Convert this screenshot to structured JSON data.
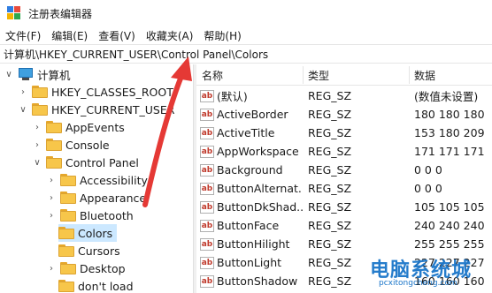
{
  "window": {
    "title": "注册表编辑器"
  },
  "menu": [
    "文件(F)",
    "编辑(E)",
    "查看(V)",
    "收藏夹(A)",
    "帮助(H)"
  ],
  "address": "计算机\\HKEY_CURRENT_USER\\Control Panel\\Colors",
  "tree": [
    {
      "label": "计算机",
      "expanded": true,
      "icon": "computer-icon"
    },
    {
      "label": "HKEY_CLASSES_ROOT",
      "expanded": false,
      "icon": "folder-icon"
    },
    {
      "label": "HKEY_CURRENT_USER",
      "expanded": true,
      "icon": "folder-icon"
    },
    {
      "label": "AppEvents",
      "expanded": false,
      "icon": "folder-icon"
    },
    {
      "label": "Console",
      "expanded": false,
      "icon": "folder-icon"
    },
    {
      "label": "Control Panel",
      "expanded": true,
      "icon": "folder-icon"
    },
    {
      "label": "Accessibility",
      "expanded": false,
      "icon": "folder-icon"
    },
    {
      "label": "Appearance",
      "expanded": false,
      "icon": "folder-icon"
    },
    {
      "label": "Bluetooth",
      "expanded": false,
      "icon": "folder-icon"
    },
    {
      "label": "Colors",
      "selected": true,
      "icon": "folder-icon"
    },
    {
      "label": "Cursors",
      "icon": "folder-icon"
    },
    {
      "label": "Desktop",
      "expanded": false,
      "icon": "folder-icon"
    },
    {
      "label": "don't load",
      "icon": "folder-icon"
    }
  ],
  "columns": {
    "name": "名称",
    "type": "类型",
    "data": "数据"
  },
  "values": [
    {
      "name": "(默认)",
      "type": "REG_SZ",
      "data": "(数值未设置)"
    },
    {
      "name": "ActiveBorder",
      "type": "REG_SZ",
      "data": "180 180 180"
    },
    {
      "name": "ActiveTitle",
      "type": "REG_SZ",
      "data": "153 180 209"
    },
    {
      "name": "AppWorkspace",
      "type": "REG_SZ",
      "data": "171 171 171"
    },
    {
      "name": "Background",
      "type": "REG_SZ",
      "data": "0 0 0"
    },
    {
      "name": "ButtonAlternat...",
      "type": "REG_SZ",
      "data": "0 0 0"
    },
    {
      "name": "ButtonDkShad...",
      "type": "REG_SZ",
      "data": "105 105 105"
    },
    {
      "name": "ButtonFace",
      "type": "REG_SZ",
      "data": "240 240 240"
    },
    {
      "name": "ButtonHilight",
      "type": "REG_SZ",
      "data": "255 255 255"
    },
    {
      "name": "ButtonLight",
      "type": "REG_SZ",
      "data": "227 227 227"
    },
    {
      "name": "ButtonShadow",
      "type": "REG_SZ",
      "data": "160 160 160"
    }
  ],
  "watermark": {
    "title": "电脑系统城",
    "url": "pcxitongcheng.com"
  },
  "colors": {
    "arrow": "#e53935",
    "selection": "#cce8ff",
    "folder": "#f7c64a"
  }
}
